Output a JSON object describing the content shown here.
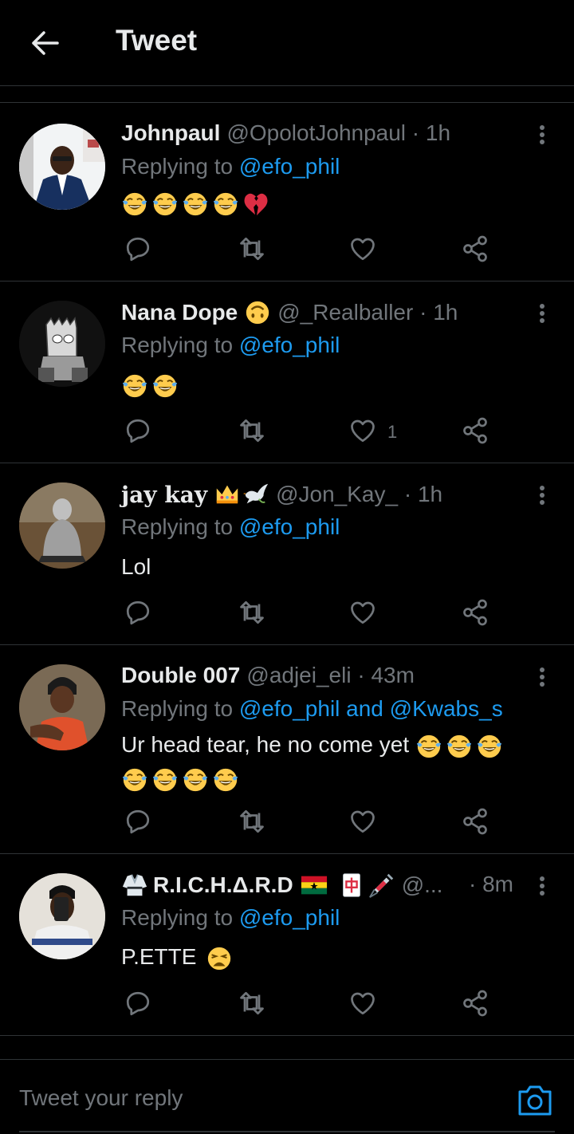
{
  "header": {
    "title": "Tweet"
  },
  "replying_prefix": "Replying to",
  "tweets": [
    {
      "name": "Johnpaul",
      "handle": "@OpolotJohnpaul · 1h",
      "reply_to": "@efo_phil",
      "text": "",
      "emojis": [
        "laughing-tears",
        "laughing-tears",
        "laughing-tears",
        "laughing-tears",
        "broken-heart"
      ],
      "likes": ""
    },
    {
      "name": "Nana Dope",
      "name_emoji": "upside-down-face",
      "handle": "@_Realballer · 1h",
      "reply_to": "@efo_phil",
      "text": "",
      "emojis": [
        "laughing-tears",
        "laughing-tears"
      ],
      "likes": "1"
    },
    {
      "name": "jay kay",
      "name_emojis": [
        "crown",
        "dove"
      ],
      "handle": "@Jon_Kay_ · 1h",
      "reply_to": "@efo_phil",
      "text": "Lol",
      "likes": ""
    },
    {
      "name": "Double 007",
      "handle": "@adjei_eli · 43m",
      "reply_to": "@efo_phil and @Kwabs_s",
      "text": "Ur head tear, he no come yet",
      "emojis": [
        "laughing-tears",
        "laughing-tears",
        "laughing-tears"
      ],
      "emojis_line2": [
        "laughing-tears",
        "laughing-tears",
        "laughing-tears",
        "laughing-tears"
      ],
      "likes": ""
    },
    {
      "name": "R.I.C.H.Δ.R.D",
      "name_emojis": [
        "martial-arts-uniform",
        "ghana-flag",
        "mahjong-red-dragon",
        "syringe"
      ],
      "handle": "@...",
      "time": "· 8m",
      "reply_to": "@efo_phil",
      "text": "P.ETTE",
      "emojis": [
        "weary-face"
      ],
      "likes": ""
    }
  ],
  "reply_bar": {
    "placeholder": "Tweet your reply"
  },
  "colors": {
    "background": "#000000",
    "accent": "#1d9bf0",
    "muted": "#71767b",
    "text": "#e7e9ea",
    "divider": "#2f3336"
  },
  "icons": [
    "back-arrow-icon",
    "more-icon",
    "reply-icon",
    "retweet-icon",
    "like-icon",
    "share-icon",
    "camera-icon"
  ]
}
